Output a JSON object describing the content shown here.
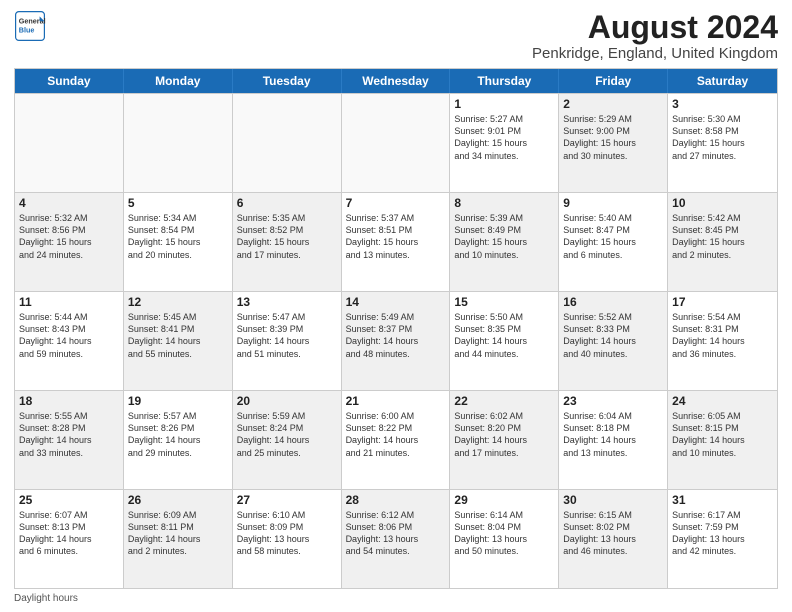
{
  "logo": {
    "general": "General",
    "blue": "Blue"
  },
  "title": "August 2024",
  "subtitle": "Penkridge, England, United Kingdom",
  "days_of_week": [
    "Sunday",
    "Monday",
    "Tuesday",
    "Wednesday",
    "Thursday",
    "Friday",
    "Saturday"
  ],
  "footer": "Daylight hours",
  "weeks": [
    [
      {
        "day": "",
        "info": "",
        "shaded": false,
        "empty": true
      },
      {
        "day": "",
        "info": "",
        "shaded": false,
        "empty": true
      },
      {
        "day": "",
        "info": "",
        "shaded": false,
        "empty": true
      },
      {
        "day": "",
        "info": "",
        "shaded": false,
        "empty": true
      },
      {
        "day": "1",
        "info": "Sunrise: 5:27 AM\nSunset: 9:01 PM\nDaylight: 15 hours\nand 34 minutes.",
        "shaded": false,
        "empty": false
      },
      {
        "day": "2",
        "info": "Sunrise: 5:29 AM\nSunset: 9:00 PM\nDaylight: 15 hours\nand 30 minutes.",
        "shaded": true,
        "empty": false
      },
      {
        "day": "3",
        "info": "Sunrise: 5:30 AM\nSunset: 8:58 PM\nDaylight: 15 hours\nand 27 minutes.",
        "shaded": false,
        "empty": false
      }
    ],
    [
      {
        "day": "4",
        "info": "Sunrise: 5:32 AM\nSunset: 8:56 PM\nDaylight: 15 hours\nand 24 minutes.",
        "shaded": true,
        "empty": false
      },
      {
        "day": "5",
        "info": "Sunrise: 5:34 AM\nSunset: 8:54 PM\nDaylight: 15 hours\nand 20 minutes.",
        "shaded": false,
        "empty": false
      },
      {
        "day": "6",
        "info": "Sunrise: 5:35 AM\nSunset: 8:52 PM\nDaylight: 15 hours\nand 17 minutes.",
        "shaded": true,
        "empty": false
      },
      {
        "day": "7",
        "info": "Sunrise: 5:37 AM\nSunset: 8:51 PM\nDaylight: 15 hours\nand 13 minutes.",
        "shaded": false,
        "empty": false
      },
      {
        "day": "8",
        "info": "Sunrise: 5:39 AM\nSunset: 8:49 PM\nDaylight: 15 hours\nand 10 minutes.",
        "shaded": true,
        "empty": false
      },
      {
        "day": "9",
        "info": "Sunrise: 5:40 AM\nSunset: 8:47 PM\nDaylight: 15 hours\nand 6 minutes.",
        "shaded": false,
        "empty": false
      },
      {
        "day": "10",
        "info": "Sunrise: 5:42 AM\nSunset: 8:45 PM\nDaylight: 15 hours\nand 2 minutes.",
        "shaded": true,
        "empty": false
      }
    ],
    [
      {
        "day": "11",
        "info": "Sunrise: 5:44 AM\nSunset: 8:43 PM\nDaylight: 14 hours\nand 59 minutes.",
        "shaded": false,
        "empty": false
      },
      {
        "day": "12",
        "info": "Sunrise: 5:45 AM\nSunset: 8:41 PM\nDaylight: 14 hours\nand 55 minutes.",
        "shaded": true,
        "empty": false
      },
      {
        "day": "13",
        "info": "Sunrise: 5:47 AM\nSunset: 8:39 PM\nDaylight: 14 hours\nand 51 minutes.",
        "shaded": false,
        "empty": false
      },
      {
        "day": "14",
        "info": "Sunrise: 5:49 AM\nSunset: 8:37 PM\nDaylight: 14 hours\nand 48 minutes.",
        "shaded": true,
        "empty": false
      },
      {
        "day": "15",
        "info": "Sunrise: 5:50 AM\nSunset: 8:35 PM\nDaylight: 14 hours\nand 44 minutes.",
        "shaded": false,
        "empty": false
      },
      {
        "day": "16",
        "info": "Sunrise: 5:52 AM\nSunset: 8:33 PM\nDaylight: 14 hours\nand 40 minutes.",
        "shaded": true,
        "empty": false
      },
      {
        "day": "17",
        "info": "Sunrise: 5:54 AM\nSunset: 8:31 PM\nDaylight: 14 hours\nand 36 minutes.",
        "shaded": false,
        "empty": false
      }
    ],
    [
      {
        "day": "18",
        "info": "Sunrise: 5:55 AM\nSunset: 8:28 PM\nDaylight: 14 hours\nand 33 minutes.",
        "shaded": true,
        "empty": false
      },
      {
        "day": "19",
        "info": "Sunrise: 5:57 AM\nSunset: 8:26 PM\nDaylight: 14 hours\nand 29 minutes.",
        "shaded": false,
        "empty": false
      },
      {
        "day": "20",
        "info": "Sunrise: 5:59 AM\nSunset: 8:24 PM\nDaylight: 14 hours\nand 25 minutes.",
        "shaded": true,
        "empty": false
      },
      {
        "day": "21",
        "info": "Sunrise: 6:00 AM\nSunset: 8:22 PM\nDaylight: 14 hours\nand 21 minutes.",
        "shaded": false,
        "empty": false
      },
      {
        "day": "22",
        "info": "Sunrise: 6:02 AM\nSunset: 8:20 PM\nDaylight: 14 hours\nand 17 minutes.",
        "shaded": true,
        "empty": false
      },
      {
        "day": "23",
        "info": "Sunrise: 6:04 AM\nSunset: 8:18 PM\nDaylight: 14 hours\nand 13 minutes.",
        "shaded": false,
        "empty": false
      },
      {
        "day": "24",
        "info": "Sunrise: 6:05 AM\nSunset: 8:15 PM\nDaylight: 14 hours\nand 10 minutes.",
        "shaded": true,
        "empty": false
      }
    ],
    [
      {
        "day": "25",
        "info": "Sunrise: 6:07 AM\nSunset: 8:13 PM\nDaylight: 14 hours\nand 6 minutes.",
        "shaded": false,
        "empty": false
      },
      {
        "day": "26",
        "info": "Sunrise: 6:09 AM\nSunset: 8:11 PM\nDaylight: 14 hours\nand 2 minutes.",
        "shaded": true,
        "empty": false
      },
      {
        "day": "27",
        "info": "Sunrise: 6:10 AM\nSunset: 8:09 PM\nDaylight: 13 hours\nand 58 minutes.",
        "shaded": false,
        "empty": false
      },
      {
        "day": "28",
        "info": "Sunrise: 6:12 AM\nSunset: 8:06 PM\nDaylight: 13 hours\nand 54 minutes.",
        "shaded": true,
        "empty": false
      },
      {
        "day": "29",
        "info": "Sunrise: 6:14 AM\nSunset: 8:04 PM\nDaylight: 13 hours\nand 50 minutes.",
        "shaded": false,
        "empty": false
      },
      {
        "day": "30",
        "info": "Sunrise: 6:15 AM\nSunset: 8:02 PM\nDaylight: 13 hours\nand 46 minutes.",
        "shaded": true,
        "empty": false
      },
      {
        "day": "31",
        "info": "Sunrise: 6:17 AM\nSunset: 7:59 PM\nDaylight: 13 hours\nand 42 minutes.",
        "shaded": false,
        "empty": false
      }
    ]
  ]
}
